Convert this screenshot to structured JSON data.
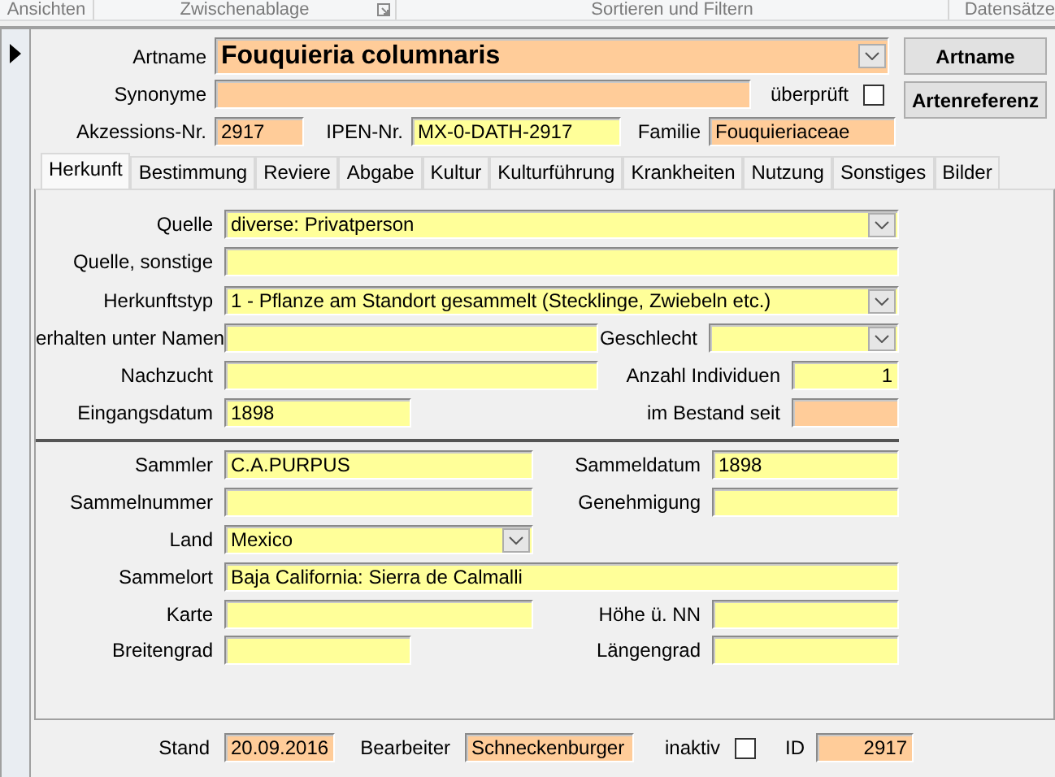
{
  "ribbon": [
    {
      "label": "Ansichten"
    },
    {
      "label": "Zwischenablage",
      "launcher": true
    },
    {
      "label": "Sortieren und Filtern"
    },
    {
      "label": "Datensätze"
    }
  ],
  "header": {
    "rows": [
      {
        "fields": [
          {
            "kind": "combo",
            "label": "Artname",
            "value": "Fouquieria columnaris",
            "color": "#ffcc99"
          }
        ]
      },
      {
        "fields": [
          {
            "kind": "text",
            "label": "Synonyme",
            "color": "#ffcc99"
          },
          {
            "kind": "check",
            "label": "überprüft",
            "checked": false
          }
        ]
      },
      {
        "fields": [
          {
            "kind": "text",
            "label": "Akzessions-Nr.",
            "value": "2917",
            "color": "#ffcc99"
          },
          {
            "kind": "text",
            "label": "IPEN-Nr.",
            "value": "MX-0-DATH-2917",
            "color": "#ffff99"
          },
          {
            "kind": "text",
            "label": "Familie",
            "value": "Fouquieriaceae",
            "color": "#ffcc99"
          }
        ]
      }
    ],
    "buttons": [
      "Artname",
      "Artenreferenz"
    ]
  },
  "tabs": [
    {
      "label": "Herkunft",
      "selected": true
    },
    {
      "label": "Bestimmung",
      "selected": false
    },
    {
      "label": "Reviere",
      "selected": false
    },
    {
      "label": "Abgabe",
      "selected": false
    },
    {
      "label": "Kultur",
      "selected": false
    },
    {
      "label": "Kulturführung",
      "selected": false
    },
    {
      "label": "Krankheiten",
      "selected": false
    },
    {
      "label": "Nutzung",
      "selected": false
    },
    {
      "label": "Sonstiges",
      "selected": false
    },
    {
      "label": "Bilder",
      "selected": false
    }
  ],
  "tab_panel": {
    "sections": [
      {
        "rows": [
          {
            "fields": [
              {
                "kind": "combo",
                "label": "Quelle",
                "value": "diverse: Privatperson",
                "color": "#ffff99"
              }
            ]
          },
          {
            "fields": [
              {
                "kind": "text",
                "label": "Quelle, sonstige",
                "color": "#ffff99"
              }
            ]
          },
          {
            "fields": [
              {
                "kind": "combo",
                "label": "Herkunftstyp",
                "value": "1 - Pflanze am Standort gesammelt (Stecklinge, Zwiebeln etc.)",
                "color": "#ffff99"
              }
            ]
          },
          {
            "fields": [
              {
                "kind": "text",
                "label": "erhalten unter Namen",
                "color": "#ffff99"
              },
              {
                "kind": "combo",
                "label": "Geschlecht",
                "color": "#ffff99"
              }
            ]
          },
          {
            "fields": [
              {
                "kind": "text",
                "label": "Nachzucht",
                "color": "#ffff99"
              },
              {
                "kind": "number",
                "label": "Anzahl Individuen",
                "value": "1",
                "color": "#ffff99"
              }
            ]
          },
          {
            "fields": [
              {
                "kind": "text",
                "label": "Eingangsdatum",
                "value": "1898",
                "color": "#ffff99"
              },
              {
                "kind": "text",
                "label": "im Bestand seit",
                "color": "#ffcc99"
              }
            ]
          }
        ]
      },
      {
        "rows": [
          {
            "fields": [
              {
                "kind": "text",
                "label": "Sammler",
                "value": "C.A.PURPUS",
                "color": "#ffff99"
              },
              {
                "kind": "text",
                "label": "Sammeldatum",
                "value": "1898",
                "color": "#ffff99"
              }
            ]
          },
          {
            "fields": [
              {
                "kind": "text",
                "label": "Sammelnummer",
                "color": "#ffff99"
              },
              {
                "kind": "text",
                "label": "Genehmigung",
                "color": "#ffff99"
              }
            ]
          },
          {
            "fields": [
              {
                "kind": "combo",
                "label": "Land",
                "value": "Mexico",
                "color": "#ffff99"
              }
            ]
          },
          {
            "fields": [
              {
                "kind": "text",
                "label": "Sammelort",
                "value": "Baja California: Sierra de Calmalli",
                "color": "#ffff99"
              }
            ]
          },
          {
            "fields": [
              {
                "kind": "text",
                "label": "Karte",
                "color": "#ffff99"
              },
              {
                "kind": "text",
                "label": "Höhe ü. NN",
                "color": "#ffff99"
              }
            ]
          },
          {
            "fields": [
              {
                "kind": "text",
                "label": "Breitengrad",
                "color": "#ffff99"
              },
              {
                "kind": "text",
                "label": "Längengrad",
                "color": "#ffff99"
              }
            ]
          }
        ]
      }
    ]
  },
  "footer": {
    "fields": [
      {
        "kind": "text",
        "label": "Stand",
        "value": "20.09.2016",
        "color": "#ffcc99"
      },
      {
        "kind": "text",
        "label": "Bearbeiter",
        "value": "Schneckenburger",
        "color": "#ffcc99"
      },
      {
        "kind": "check",
        "label": "inaktiv",
        "checked": false
      },
      {
        "kind": "number",
        "label": "ID",
        "value": "2917",
        "color": "#ffcc99"
      }
    ]
  }
}
